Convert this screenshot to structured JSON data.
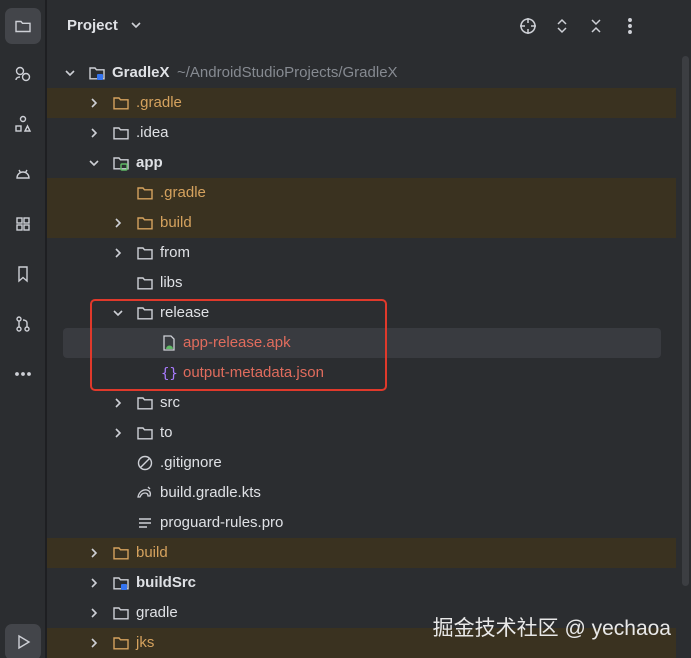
{
  "panel": {
    "title": "Project",
    "header_icons": [
      "crosshair-icon",
      "expand-collapse-icon",
      "collapse-all-icon",
      "more-vertical-icon"
    ]
  },
  "toolstrip": [
    "folder-icon",
    "commit-icon",
    "structure-icon",
    "android-icon",
    "plugins-icon",
    "bookmark-icon",
    "git-branch-icon",
    "more-horizontal-icon",
    "run-icon"
  ],
  "tree": {
    "root": {
      "label": "GradleX",
      "path": "~/AndroidStudioProjects/GradleX"
    },
    "items": [
      {
        "label": ".gradle"
      },
      {
        "label": ".idea"
      },
      {
        "label": "app"
      },
      {
        "label": ".gradle"
      },
      {
        "label": "build"
      },
      {
        "label": "from"
      },
      {
        "label": "libs"
      },
      {
        "label": "release"
      },
      {
        "label": "app-release.apk"
      },
      {
        "label": "output-metadata.json"
      },
      {
        "label": "src"
      },
      {
        "label": "to"
      },
      {
        "label": ".gitignore"
      },
      {
        "label": "build.gradle.kts"
      },
      {
        "label": "proguard-rules.pro"
      },
      {
        "label": "build"
      },
      {
        "label": "buildSrc"
      },
      {
        "label": "gradle"
      },
      {
        "label": "jks"
      }
    ]
  },
  "watermark": "掘金技术社区 @ yechaoa",
  "colors": {
    "excluded": "#d5a25e",
    "apk": "#e06c5d",
    "highlight_box": "#e0392b",
    "selection": "#393b40"
  }
}
